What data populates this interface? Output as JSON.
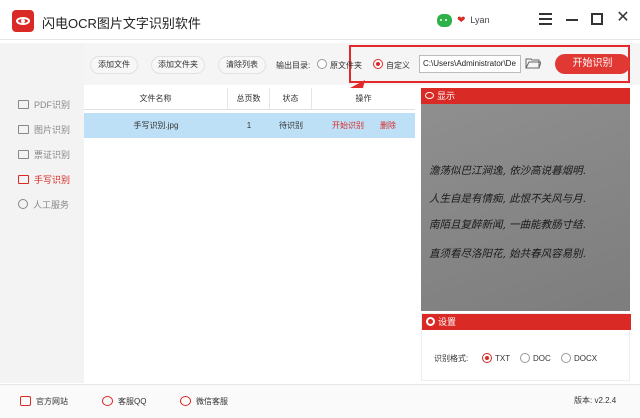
{
  "app": {
    "title": "闪电OCR图片文字识别软件",
    "user_name": "Lyan",
    "close_glyph": "✕",
    "heart_glyph": "❤"
  },
  "toolbar": {
    "add_file": "添加文件",
    "add_folder": "添加文件夹",
    "clear_list": "清除列表",
    "output_label": "输出目录:",
    "option_original": "原文件夹",
    "option_custom": "自定义",
    "output_path": "C:\\Users\\Administrator\\De",
    "start_button": "开始识别"
  },
  "sidebar": {
    "items": [
      {
        "label": "PDF识别",
        "icon": "pdf-icon"
      },
      {
        "label": "图片识别",
        "icon": "image-icon"
      },
      {
        "label": "票证识别",
        "icon": "ticket-icon"
      },
      {
        "label": "手写识别",
        "icon": "handwriting-icon",
        "active": true
      },
      {
        "label": "人工服务",
        "icon": "person-icon"
      }
    ]
  },
  "table": {
    "headers": [
      "文件名称",
      "总页数",
      "状态",
      "操作"
    ],
    "rows": [
      {
        "name": "手写识别.jpg",
        "pages": "1",
        "status": "待识别",
        "action_start": "开始识别",
        "action_delete": "删除"
      }
    ]
  },
  "preview": {
    "title": "显示",
    "handwriting": [
      "澹荡似巴江涧逸, 依沙高说暮烟明.",
      "人生自是有情痴, 此恨不关风与月.",
      "南陌且复醉新闻, 一曲能教肠寸结.",
      "直须看尽洛阳花, 始共春风容易别."
    ]
  },
  "settings": {
    "title": "设置",
    "format_label": "识别格式:",
    "formats": [
      "TXT",
      "DOC",
      "DOCX"
    ],
    "selected_format": "TXT"
  },
  "footer": {
    "official_site": "官方网站",
    "qq_service": "客服QQ",
    "wechat_service": "微信客服",
    "version": "版本: v2.2.4"
  },
  "colors": {
    "accent": "#d92a26",
    "row_selected": "#bde0f7",
    "highlight_box": "#e32a2a"
  }
}
